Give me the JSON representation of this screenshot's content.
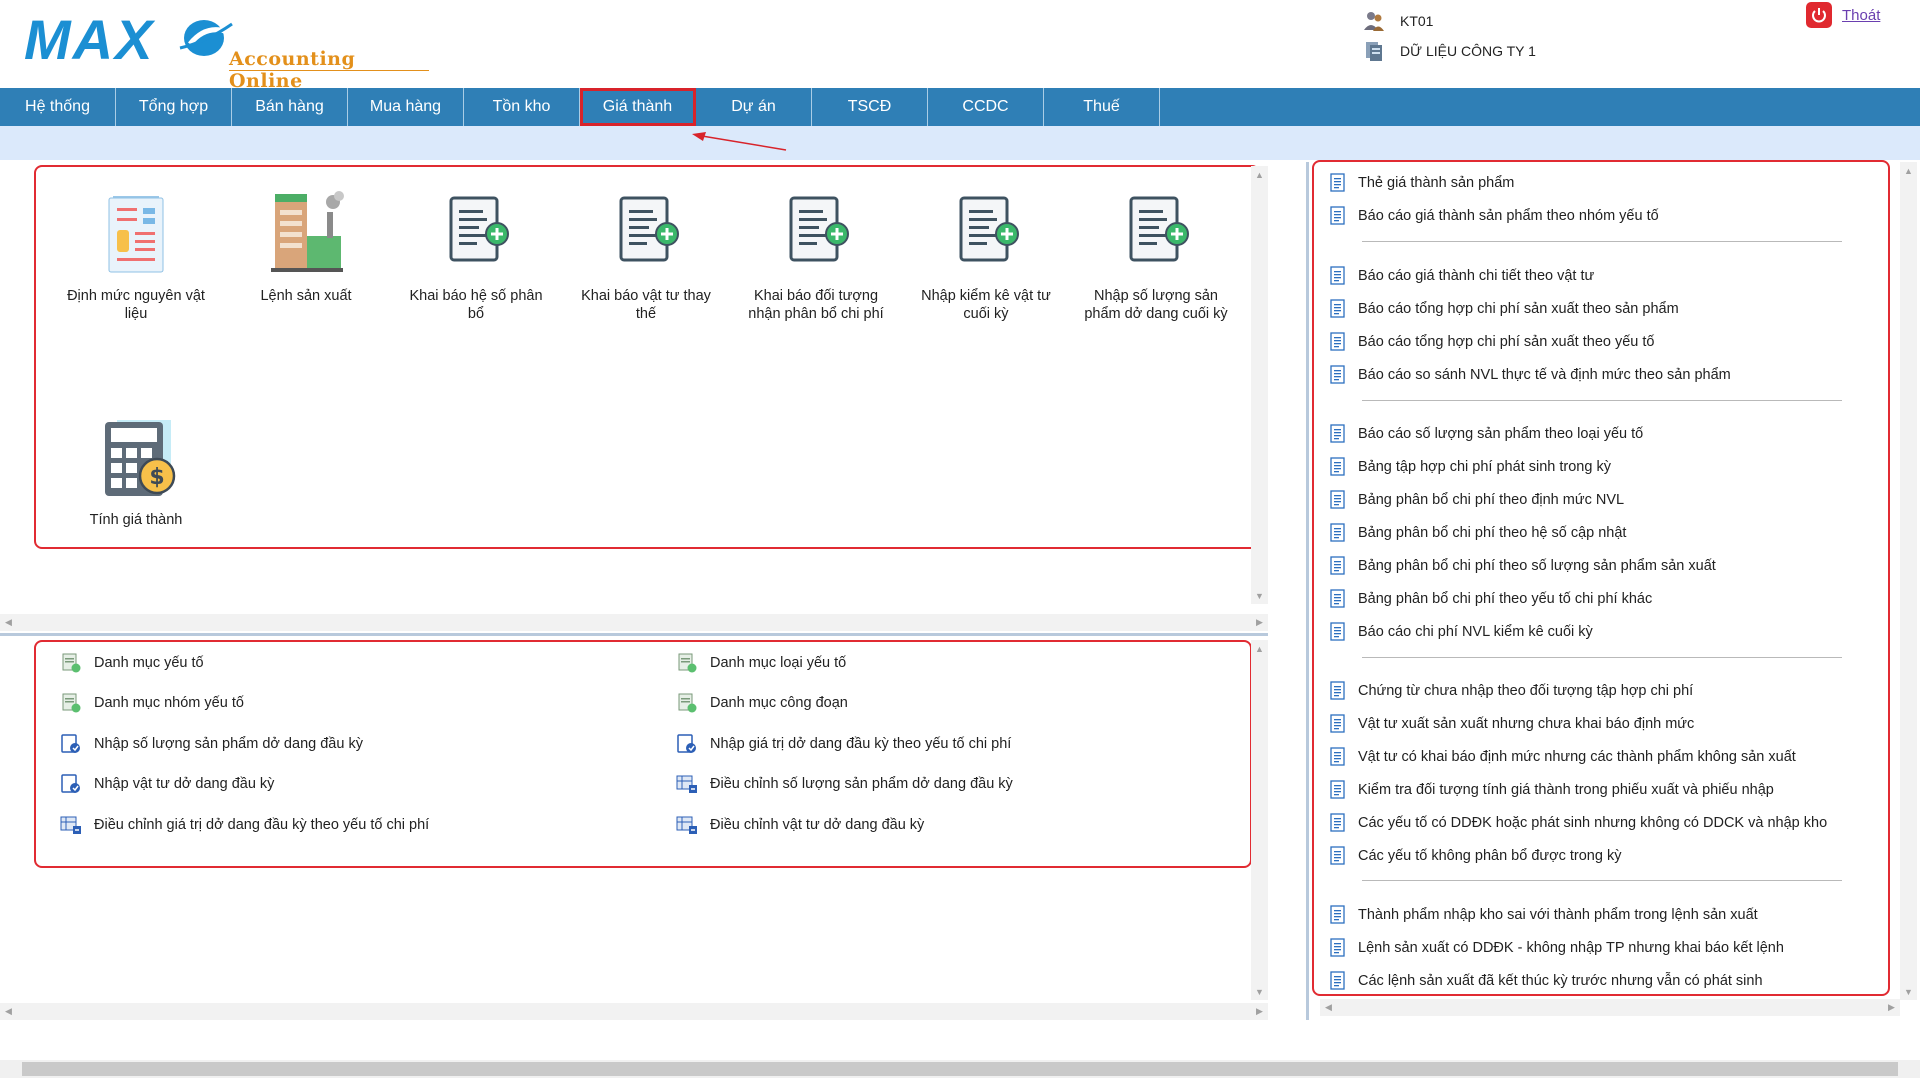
{
  "header": {
    "logo_text": "MAX",
    "logo_sub": "Accounting Online",
    "user_code": "KT01",
    "company": "DỮ LIỆU CÔNG TY 1",
    "logout": "Thoát"
  },
  "menu": [
    "Hệ thống",
    "Tổng hợp",
    "Bán hàng",
    "Mua hàng",
    "Tồn kho",
    "Giá thành",
    "Dự án",
    "TSCĐ",
    "CCDC",
    "Thuế"
  ],
  "active_menu": "Giá thành",
  "tiles": [
    {
      "label": "Định mức nguyên vật liệu",
      "icon": "form-document-icon"
    },
    {
      "label": "Lệnh sản xuất",
      "icon": "factory-icon"
    },
    {
      "label": "Khai báo hệ số phân bổ",
      "icon": "document-add-icon"
    },
    {
      "label": "Khai báo vật tư thay thế",
      "icon": "document-add-icon"
    },
    {
      "label": "Khai báo đối tượng nhận phân bổ chi phí",
      "icon": "document-add-icon"
    },
    {
      "label": "Nhập kiểm kê vật tư cuối kỳ",
      "icon": "document-add-icon"
    },
    {
      "label": "Nhập số lượng sản phẩm dở dang cuối kỳ",
      "icon": "document-add-icon"
    },
    {
      "label": "Tính giá thành",
      "icon": "calculator-money-icon"
    }
  ],
  "lower_left": [
    {
      "label": "Danh mục yếu tố",
      "icon": "catalog-icon"
    },
    {
      "label": "Danh mục nhóm yếu tố",
      "icon": "catalog-icon"
    },
    {
      "label": "Nhập số lượng sản phẩm dở dang đầu kỳ",
      "icon": "entry-form-icon"
    },
    {
      "label": "Nhập vật tư dở dang đầu kỳ",
      "icon": "entry-form-icon"
    },
    {
      "label": "Điều chỉnh giá trị dở dang đầu kỳ theo yếu tố chi phí",
      "icon": "adjust-grid-icon"
    }
  ],
  "lower_right": [
    {
      "label": "Danh mục loại yếu tố",
      "icon": "catalog-icon"
    },
    {
      "label": "Danh mục công đoạn",
      "icon": "catalog-icon"
    },
    {
      "label": "Nhập giá trị dở dang đầu kỳ theo yếu tố chi phí",
      "icon": "entry-form-icon"
    },
    {
      "label": "Điều chỉnh số lượng sản phẩm dở dang đầu kỳ",
      "icon": "adjust-grid-icon"
    },
    {
      "label": "Điều chỉnh vật tư dở dang đầu kỳ",
      "icon": "adjust-grid-icon"
    }
  ],
  "reports": [
    [
      "Thẻ giá thành sản phẩm",
      "Báo cáo giá thành sản phẩm theo nhóm yếu tố"
    ],
    [
      "Báo cáo giá thành chi tiết theo vật tư",
      "Báo cáo tổng hợp chi phí sản xuất theo sản phẩm",
      "Báo cáo tổng hợp chi phí sản xuất theo yếu tố",
      "Báo cáo so sánh NVL thực tế và định mức theo sản phẩm"
    ],
    [
      "Báo cáo số lượng sản phẩm theo loại yếu tố",
      "Bảng tập hợp chi phí phát sinh trong kỳ",
      "Bảng phân bổ chi phí theo định mức NVL",
      "Bảng phân bổ chi phí theo hệ số cập nhật",
      "Bảng phân bổ chi phí theo số lượng sản phẩm sản xuất",
      "Bảng phân bổ chi phí theo yếu tố chi phí khác",
      "Báo cáo chi phí NVL kiểm kê cuối kỳ"
    ],
    [
      "Chứng từ chưa nhập theo đối tượng tập hợp chi phí",
      "Vật tư xuất sản xuất nhưng chưa khai báo định mức",
      "Vật tư có khai báo định mức nhưng các thành phẩm không sản xuất",
      "Kiểm tra đối tượng tính giá thành trong phiếu xuất và phiếu nhập",
      "Các yếu tố có DDĐK hoặc phát sinh nhưng không có DDCK và nhập kho",
      "Các yếu tố không phân bổ được trong kỳ"
    ],
    [
      "Thành phẩm nhập kho sai với thành phẩm trong lệnh sản xuất",
      "Lệnh sản xuất có DDĐK - không nhập TP nhưng khai báo kết lệnh",
      "Các lệnh sản xuất đã kết thúc kỳ trước nhưng vẫn có phát sinh"
    ]
  ],
  "colors": {
    "menu_bg": "#2f7fb6",
    "subbar_bg": "#dbe9fb",
    "highlight": "#e12b32",
    "logo_blue": "#1b8fd3",
    "logo_orange": "#e3901b"
  }
}
